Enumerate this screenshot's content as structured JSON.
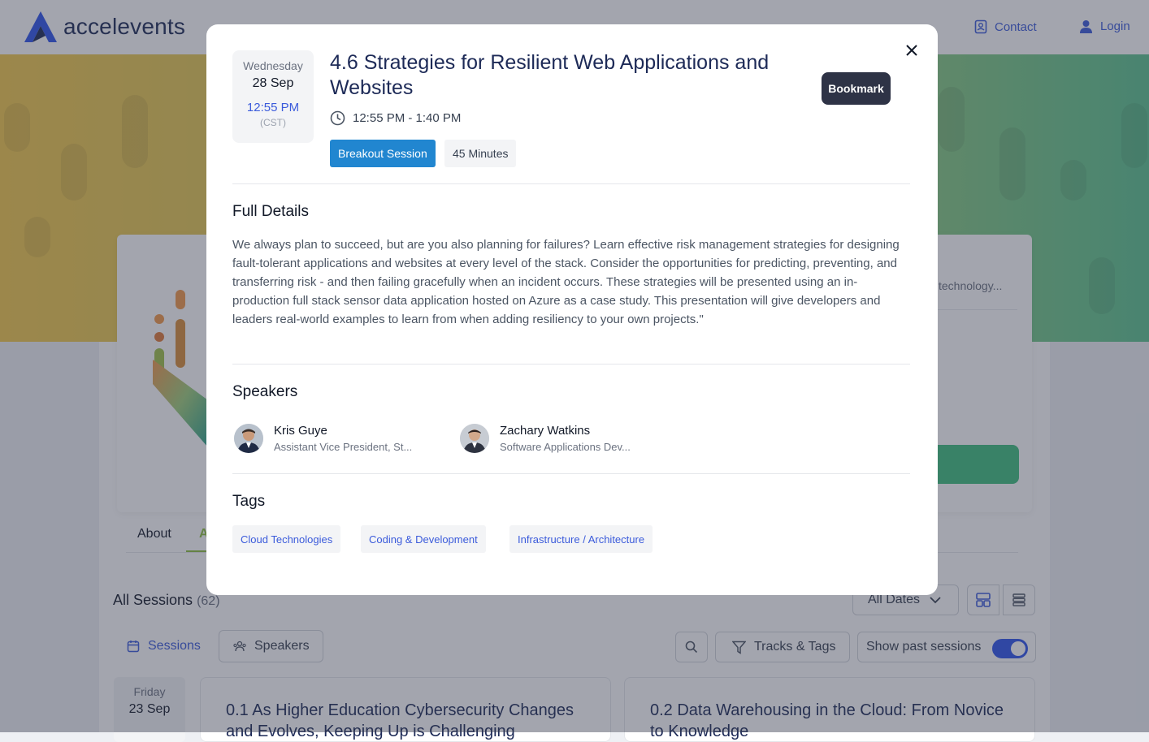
{
  "header": {
    "brand": "accelevents",
    "contact_label": "Contact",
    "login_label": "Login"
  },
  "background": {
    "event_description": "technology...",
    "tabs": {
      "about": "About",
      "agenda_fragment": "A"
    },
    "all_sessions": {
      "label": "All Sessions",
      "count": "(62)"
    },
    "dates_select": "All Dates",
    "sub_tabs": {
      "sessions": "Sessions",
      "speakers": "Speakers"
    },
    "filters": {
      "tracks": "Tracks & Tags",
      "past_sessions": "Show past sessions"
    },
    "date_col": {
      "dow": "Friday",
      "dom": "23 Sep"
    },
    "session_cards": [
      {
        "title": "0.1 As Higher Education Cybersecurity Changes and Evolves, Keeping Up is Challenging"
      },
      {
        "title": "0.2 Data Warehousing in the Cloud: From Novice to Knowledge"
      }
    ]
  },
  "modal": {
    "date": {
      "dow": "Wednesday",
      "dom": "28 Sep",
      "time": "12:55 PM",
      "tz": "(CST)"
    },
    "title": "4.6 Strategies for Resilient Web Applications and Websites",
    "time_range": "12:55 PM - 1:40 PM",
    "session_type": "Breakout Session",
    "duration": "45 Minutes",
    "bookmark_label": "Bookmark",
    "details_heading": "Full Details",
    "details_text": "We always plan to succeed, but are you also planning for failures? Learn effective risk management strategies for designing fault-tolerant applications and websites at every level of the stack. Consider the opportunities for predicting, preventing, and transferring risk - and then failing gracefully when an incident occurs. These strategies will be presented using an in-production full stack sensor data application hosted on Azure as a case study. This presentation will give developers and leaders real-world examples to learn from when adding resiliency to your own projects.\"",
    "speakers_heading": "Speakers",
    "speakers": [
      {
        "name": "Kris Guye",
        "title": "Assistant Vice President, St..."
      },
      {
        "name": "Zachary Watkins",
        "title": "Software Applications Dev..."
      }
    ],
    "tags_heading": "Tags",
    "tags": [
      "Cloud Technologies",
      "Coding & Development",
      "Infrastructure / Architecture"
    ]
  },
  "colors": {
    "accent": "#3b5bdb",
    "badge": "#2186d0",
    "bookmark": "#2e3346",
    "brand_dark": "#1d2a57"
  }
}
